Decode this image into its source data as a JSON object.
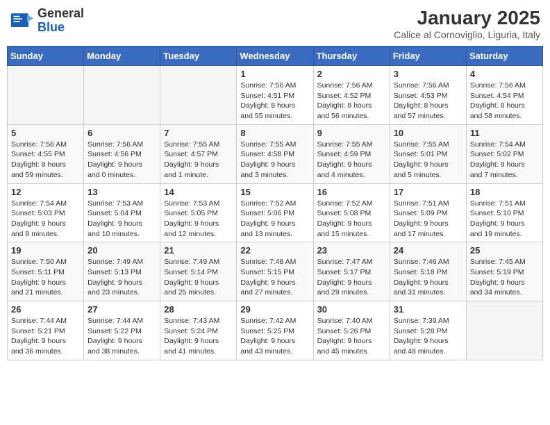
{
  "header": {
    "logo": {
      "general": "General",
      "blue": "Blue"
    },
    "month_title": "January 2025",
    "subtitle": "Calice al Cornoviglio, Liguria, Italy"
  },
  "calendar": {
    "days_of_week": [
      "Sunday",
      "Monday",
      "Tuesday",
      "Wednesday",
      "Thursday",
      "Friday",
      "Saturday"
    ],
    "weeks": [
      [
        {
          "day": "",
          "info": ""
        },
        {
          "day": "",
          "info": ""
        },
        {
          "day": "",
          "info": ""
        },
        {
          "day": "1",
          "info": "Sunrise: 7:56 AM\nSunset: 4:51 PM\nDaylight: 8 hours\nand 55 minutes."
        },
        {
          "day": "2",
          "info": "Sunrise: 7:56 AM\nSunset: 4:52 PM\nDaylight: 8 hours\nand 56 minutes."
        },
        {
          "day": "3",
          "info": "Sunrise: 7:56 AM\nSunset: 4:53 PM\nDaylight: 8 hours\nand 57 minutes."
        },
        {
          "day": "4",
          "info": "Sunrise: 7:56 AM\nSunset: 4:54 PM\nDaylight: 8 hours\nand 58 minutes."
        }
      ],
      [
        {
          "day": "5",
          "info": "Sunrise: 7:56 AM\nSunset: 4:55 PM\nDaylight: 8 hours\nand 59 minutes."
        },
        {
          "day": "6",
          "info": "Sunrise: 7:56 AM\nSunset: 4:56 PM\nDaylight: 9 hours\nand 0 minutes."
        },
        {
          "day": "7",
          "info": "Sunrise: 7:55 AM\nSunset: 4:57 PM\nDaylight: 9 hours\nand 1 minute."
        },
        {
          "day": "8",
          "info": "Sunrise: 7:55 AM\nSunset: 4:58 PM\nDaylight: 9 hours\nand 3 minutes."
        },
        {
          "day": "9",
          "info": "Sunrise: 7:55 AM\nSunset: 4:59 PM\nDaylight: 9 hours\nand 4 minutes."
        },
        {
          "day": "10",
          "info": "Sunrise: 7:55 AM\nSunset: 5:01 PM\nDaylight: 9 hours\nand 5 minutes."
        },
        {
          "day": "11",
          "info": "Sunrise: 7:54 AM\nSunset: 5:02 PM\nDaylight: 9 hours\nand 7 minutes."
        }
      ],
      [
        {
          "day": "12",
          "info": "Sunrise: 7:54 AM\nSunset: 5:03 PM\nDaylight: 9 hours\nand 8 minutes."
        },
        {
          "day": "13",
          "info": "Sunrise: 7:53 AM\nSunset: 5:04 PM\nDaylight: 9 hours\nand 10 minutes."
        },
        {
          "day": "14",
          "info": "Sunrise: 7:53 AM\nSunset: 5:05 PM\nDaylight: 9 hours\nand 12 minutes."
        },
        {
          "day": "15",
          "info": "Sunrise: 7:52 AM\nSunset: 5:06 PM\nDaylight: 9 hours\nand 13 minutes."
        },
        {
          "day": "16",
          "info": "Sunrise: 7:52 AM\nSunset: 5:08 PM\nDaylight: 9 hours\nand 15 minutes."
        },
        {
          "day": "17",
          "info": "Sunrise: 7:51 AM\nSunset: 5:09 PM\nDaylight: 9 hours\nand 17 minutes."
        },
        {
          "day": "18",
          "info": "Sunrise: 7:51 AM\nSunset: 5:10 PM\nDaylight: 9 hours\nand 19 minutes."
        }
      ],
      [
        {
          "day": "19",
          "info": "Sunrise: 7:50 AM\nSunset: 5:11 PM\nDaylight: 9 hours\nand 21 minutes."
        },
        {
          "day": "20",
          "info": "Sunrise: 7:49 AM\nSunset: 5:13 PM\nDaylight: 9 hours\nand 23 minutes."
        },
        {
          "day": "21",
          "info": "Sunrise: 7:49 AM\nSunset: 5:14 PM\nDaylight: 9 hours\nand 25 minutes."
        },
        {
          "day": "22",
          "info": "Sunrise: 7:48 AM\nSunset: 5:15 PM\nDaylight: 9 hours\nand 27 minutes."
        },
        {
          "day": "23",
          "info": "Sunrise: 7:47 AM\nSunset: 5:17 PM\nDaylight: 9 hours\nand 29 minutes."
        },
        {
          "day": "24",
          "info": "Sunrise: 7:46 AM\nSunset: 5:18 PM\nDaylight: 9 hours\nand 31 minutes."
        },
        {
          "day": "25",
          "info": "Sunrise: 7:45 AM\nSunset: 5:19 PM\nDaylight: 9 hours\nand 34 minutes."
        }
      ],
      [
        {
          "day": "26",
          "info": "Sunrise: 7:44 AM\nSunset: 5:21 PM\nDaylight: 9 hours\nand 36 minutes."
        },
        {
          "day": "27",
          "info": "Sunrise: 7:44 AM\nSunset: 5:22 PM\nDaylight: 9 hours\nand 38 minutes."
        },
        {
          "day": "28",
          "info": "Sunrise: 7:43 AM\nSunset: 5:24 PM\nDaylight: 9 hours\nand 41 minutes."
        },
        {
          "day": "29",
          "info": "Sunrise: 7:42 AM\nSunset: 5:25 PM\nDaylight: 9 hours\nand 43 minutes."
        },
        {
          "day": "30",
          "info": "Sunrise: 7:40 AM\nSunset: 5:26 PM\nDaylight: 9 hours\nand 45 minutes."
        },
        {
          "day": "31",
          "info": "Sunrise: 7:39 AM\nSunset: 5:28 PM\nDaylight: 9 hours\nand 48 minutes."
        },
        {
          "day": "",
          "info": ""
        }
      ]
    ]
  }
}
